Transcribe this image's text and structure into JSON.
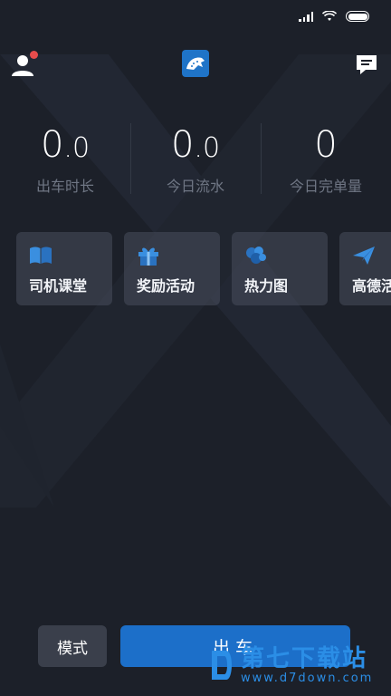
{
  "header": {
    "user_icon": "user-icon",
    "logo_icon": "leopard-logo-icon",
    "message_icon": "message-icon",
    "colors": {
      "background": "#1c2029",
      "notification_dot": "#e74c4c",
      "brand": "#1f74c8"
    }
  },
  "stats": [
    {
      "int": "0",
      "dec": ".0",
      "label": "出车时长"
    },
    {
      "int": "0",
      "dec": ".0",
      "label": "今日流水"
    },
    {
      "int": "0",
      "dec": "",
      "label": "今日完单量"
    }
  ],
  "tools": [
    {
      "label": "司机课堂",
      "icon": "book-icon"
    },
    {
      "label": "奖励活动",
      "icon": "gift-icon"
    },
    {
      "label": "热力图",
      "icon": "heatmap-icon"
    },
    {
      "label": "高德活",
      "icon": "paper-plane-icon"
    }
  ],
  "bottom": {
    "mode_label": "模式",
    "go_label": "出车",
    "go_color": "#1c6fc9"
  },
  "watermark": {
    "name": "第七下载站",
    "url": "www.d7down.com"
  }
}
